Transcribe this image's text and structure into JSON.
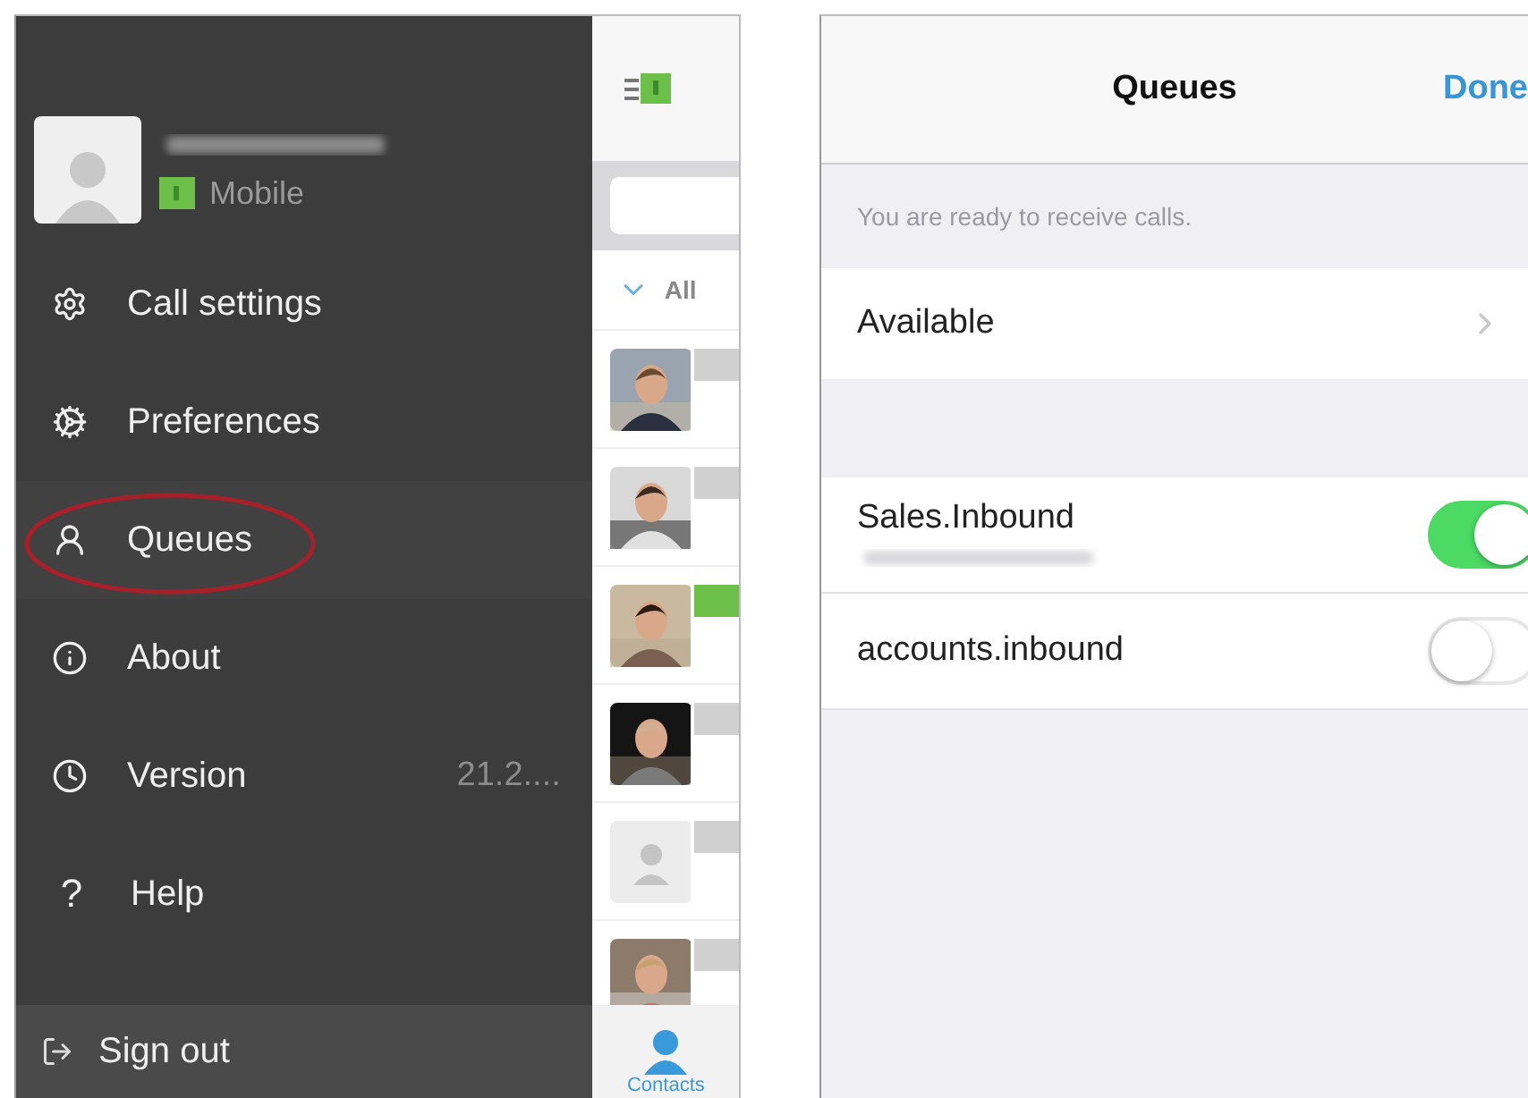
{
  "drawer": {
    "user": {
      "status": "Mobile"
    },
    "menu": [
      {
        "label": "Call settings",
        "selected": false
      },
      {
        "label": "Preferences",
        "selected": false
      },
      {
        "label": "Queues",
        "selected": true
      },
      {
        "label": "About",
        "selected": false
      },
      {
        "label": "Version",
        "selected": false,
        "value": "21.2...."
      },
      {
        "label": "Help",
        "glyph": "?",
        "selected": false
      }
    ],
    "sign_out": "Sign out"
  },
  "contacts": {
    "group": "All",
    "rows": [
      {
        "kind": "picture",
        "color": "#d0d0d0"
      },
      {
        "kind": "picture",
        "color": "#d0d0d0"
      },
      {
        "kind": "picture",
        "color": "#6cc04a"
      },
      {
        "kind": "picture",
        "color": "#d0d0d0"
      },
      {
        "kind": "placeholder",
        "color": "#d0d0d0"
      },
      {
        "kind": "picture",
        "color": "#d0d0d0"
      }
    ],
    "tab": {
      "label": "Contacts",
      "selected": true
    }
  },
  "queues": {
    "title": "Queues",
    "done": "Done",
    "notice": "You are ready to receive calls.",
    "availability": "Available",
    "items": [
      {
        "name": "Sales.Inbound",
        "on": true,
        "number_hidden": true
      },
      {
        "name": "accounts.inbound",
        "on": false,
        "number_hidden": false
      }
    ]
  }
}
